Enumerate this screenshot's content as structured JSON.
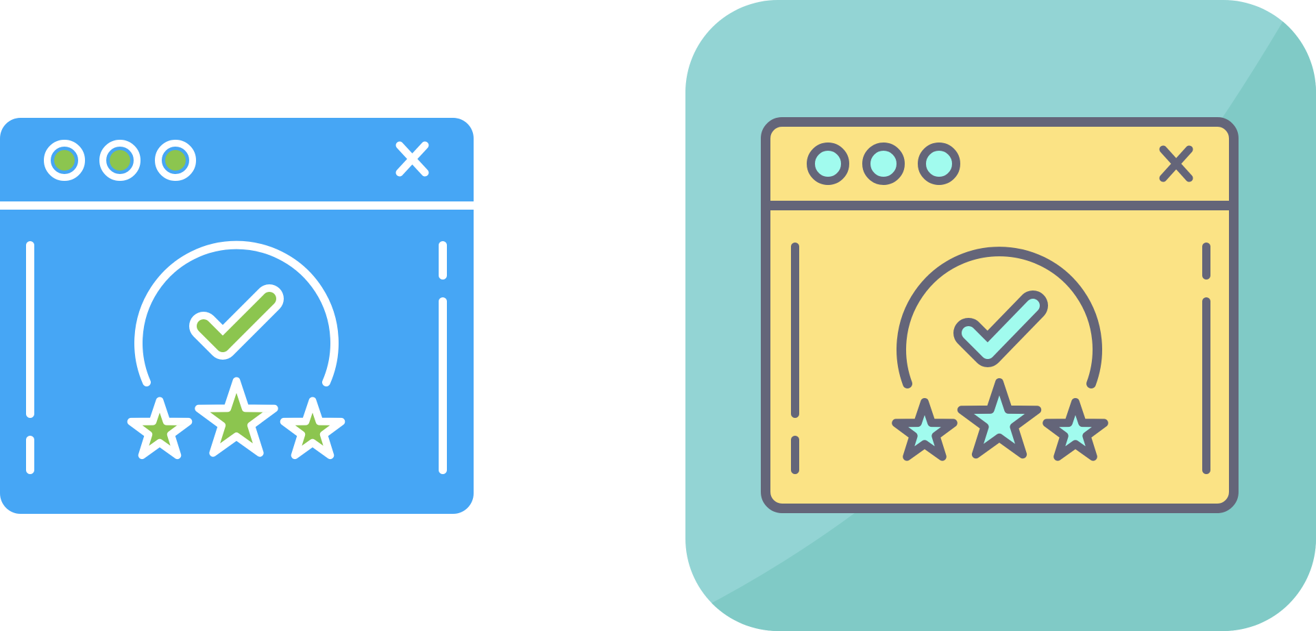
{
  "icons": [
    {
      "name": "browser-rating-icon-flat-blue",
      "style": "glyph",
      "colors": {
        "window": "#46a6f5",
        "stroke": "#ffffff",
        "accent": "#8cc54f"
      },
      "window_dots": 3,
      "stars": 3,
      "has_checkmark": true,
      "has_close_button": true
    },
    {
      "name": "browser-rating-icon-lineal-color",
      "style": "lineal-color",
      "colors": {
        "background_tile": "#93d4d4",
        "background_tile_shade": "#80cac6",
        "window": "#fbe385",
        "stroke": "#646579",
        "accent": "#a1fbee"
      },
      "window_dots": 3,
      "stars": 3,
      "has_checkmark": true,
      "has_close_button": true
    }
  ]
}
